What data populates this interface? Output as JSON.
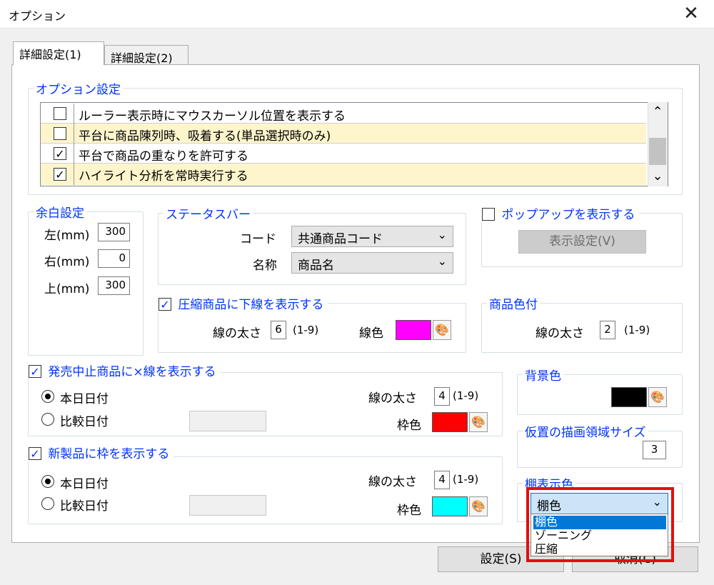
{
  "window": {
    "title": "オプション",
    "close_glyph": "✕"
  },
  "tabs": [
    {
      "label": "詳細設定(1)",
      "active": true
    },
    {
      "label": "詳細設定(2)",
      "active": false
    }
  ],
  "option_settings": {
    "legend": "オプション設定",
    "items": [
      {
        "label": "ルーラー表示時にマウスカーソル位置を表示する",
        "checked": false,
        "highlighted": false
      },
      {
        "label": "平台に商品陳列時、吸着する(単品選択時のみ)",
        "checked": false,
        "highlighted": true
      },
      {
        "label": "平台で商品の重なりを許可する",
        "checked": true,
        "highlighted": false
      },
      {
        "label": "ハイライト分析を常時実行する",
        "checked": true,
        "highlighted": true
      }
    ],
    "scroll_up": "⌃",
    "scroll_down": "⌄"
  },
  "margin": {
    "legend": "余白設定",
    "left_label": "左(mm)",
    "left_value": "300",
    "right_label": "右(mm)",
    "right_value": "0",
    "top_label": "上(mm)",
    "top_value": "300"
  },
  "statusbar": {
    "legend": "ステータスバー",
    "code_label": "コード",
    "code_value": "共通商品コード",
    "name_label": "名称",
    "name_value": "商品名"
  },
  "popup": {
    "label": "ポップアップを表示する",
    "checked": false,
    "button_label": "表示設定(V)"
  },
  "compressed": {
    "label": "圧縮商品に下線を表示する",
    "checked": true,
    "width_label": "線の太さ",
    "width_value": "6",
    "range": "(1-9)",
    "color_label": "線色",
    "color": "#ff00ff"
  },
  "product_color": {
    "legend": "商品色付",
    "width_label": "線の太さ",
    "width_value": "2",
    "range": "(1-9)"
  },
  "discontinued": {
    "label": "発売中止商品に×線を表示する",
    "checked": true,
    "radio_today": "本日日付",
    "radio_compare": "比較日付",
    "selected": "today",
    "width_label": "線の太さ",
    "width_value": "4",
    "range": "(1-9)",
    "color_label": "枠色",
    "color": "#ff0000"
  },
  "background": {
    "legend": "背景色",
    "color": "#000000"
  },
  "new_product": {
    "label": "新製品に枠を表示する",
    "checked": true,
    "radio_today": "本日日付",
    "radio_compare": "比較日付",
    "selected": "today",
    "width_label": "線の太さ",
    "width_value": "4",
    "range": "(1-9)",
    "color_label": "枠色",
    "color": "#00ffff"
  },
  "temp_area": {
    "legend": "仮置の描画領域サイズ",
    "value": "3"
  },
  "shelf_color": {
    "legend": "棚表示色",
    "selected": "棚色",
    "options": [
      "棚色",
      "ゾーニング",
      "圧縮"
    ]
  },
  "footer": {
    "ok_label": "設定(S)",
    "cancel_label": "取消(C)"
  },
  "icons": {
    "palette": "palette-icon",
    "chevron": "⌄"
  }
}
